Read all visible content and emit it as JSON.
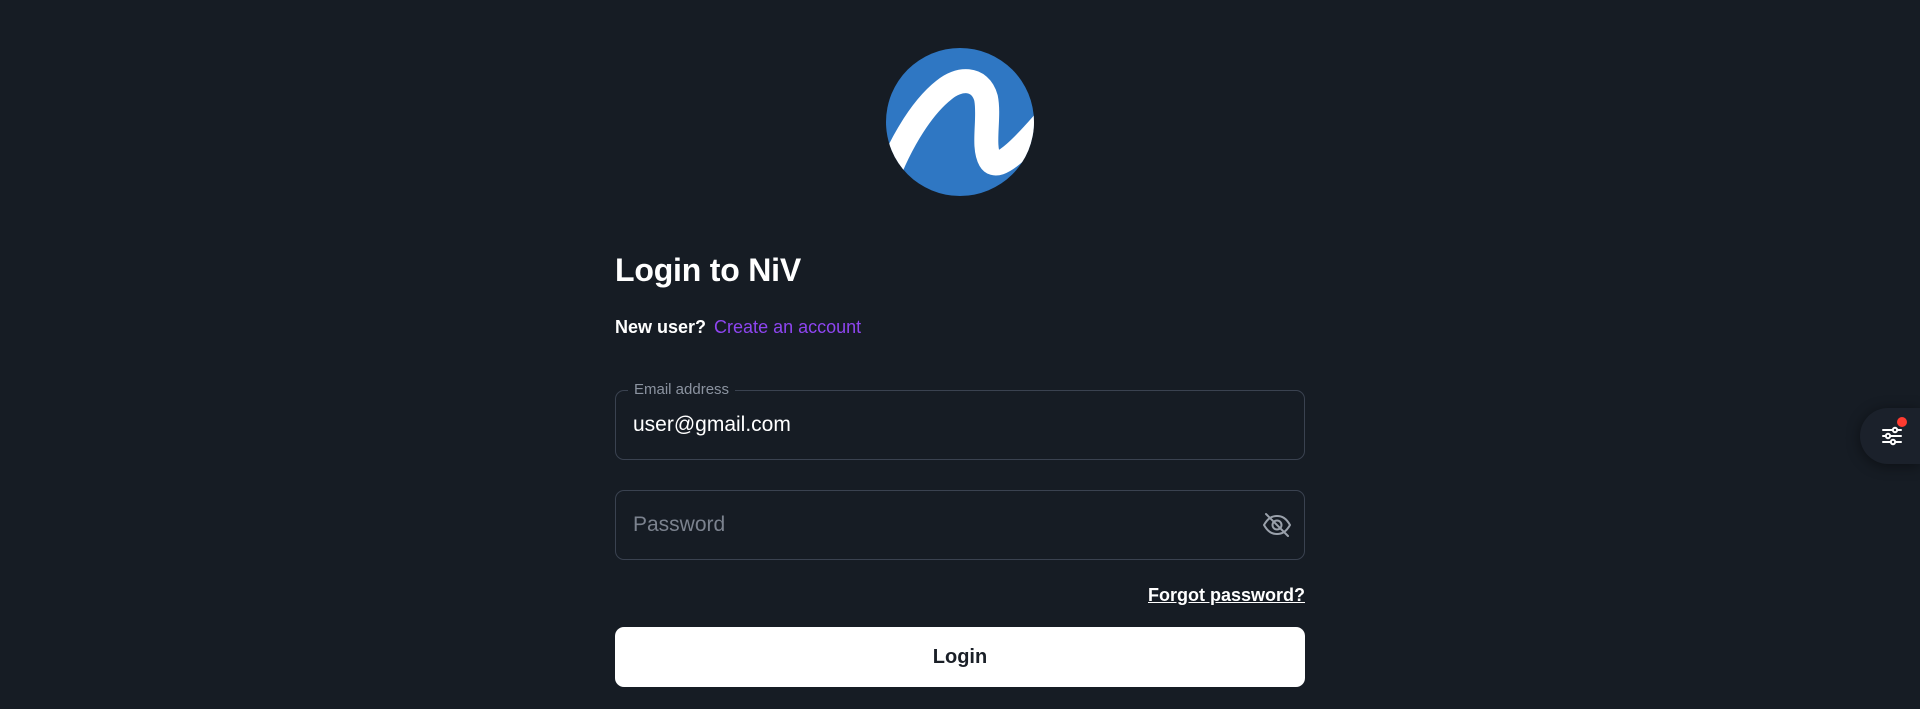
{
  "brand": {
    "logo_icon": "niv-logo-icon",
    "logo_color": "#2f77c3"
  },
  "login": {
    "title": "Login to NiV",
    "new_user_text": "New user?",
    "create_account_link": "Create an account",
    "email": {
      "label": "Email address",
      "value": "user@gmail.com"
    },
    "password": {
      "placeholder": "Password",
      "toggle_icon": "eye-off-icon"
    },
    "forgot_password_link": "Forgot password?",
    "submit_label": "Login"
  },
  "settings_fab": {
    "icon": "sliders-icon",
    "has_notification": true,
    "notification_color": "#ff3b30"
  },
  "colors": {
    "background": "#161c24",
    "accent_link": "#8e45f0",
    "field_border": "#3a4250",
    "button_bg": "#ffffff"
  }
}
